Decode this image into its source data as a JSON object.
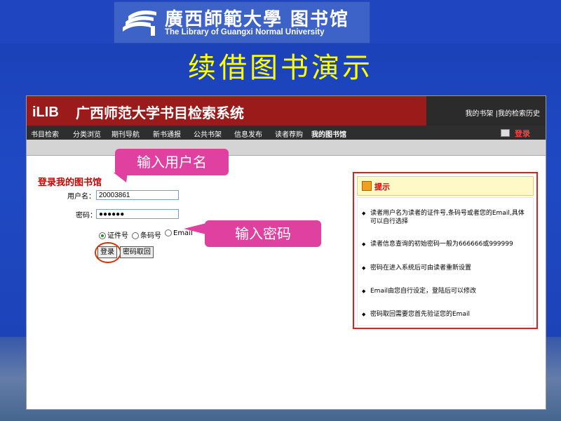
{
  "logo": {
    "cn": "廣西師範大學 图书馆",
    "en": "The Library of Guangxi Normal University"
  },
  "slide_title": "续借图书演示",
  "app": {
    "brand": "iLIB",
    "title": "广西师范大学书目检索系统",
    "header_links": "我的书架 |我的检索历史"
  },
  "nav": {
    "items": [
      "书目检索",
      "分类浏览",
      "期刊导航",
      "新书通报",
      "公共书架",
      "信息发布",
      "读者荐购",
      "我的图书馆"
    ],
    "login": "登录"
  },
  "form": {
    "title": "登录我的图书馆",
    "username_label": "用户名：",
    "username_value": "20003861",
    "password_label": "密码：",
    "password_value": "●●●●●●",
    "radio_options": [
      "证件号",
      "条码号",
      "Email"
    ],
    "radio_selected": "证件号",
    "login_button": "登录",
    "recover_button": "密码取回"
  },
  "tips": {
    "title": "提示",
    "items": [
      "读者用户名为读者的证件号,条码号或者您的Email,具体可以自行选择",
      "读者信息查询的初始密码一般为666666或999999",
      "密码在进入系统后可由读者重新设置",
      "Email由您自行设定，登陆后可以修改",
      "密码取回需要您首先验证您的Email"
    ]
  },
  "callouts": {
    "username": "输入用户名",
    "password": "输入密码"
  },
  "colors": {
    "background": "#1f46c0",
    "title": "#ffff00",
    "header": "#9b1a1a",
    "callout": "#e040a0",
    "highlight": "#e02020"
  }
}
